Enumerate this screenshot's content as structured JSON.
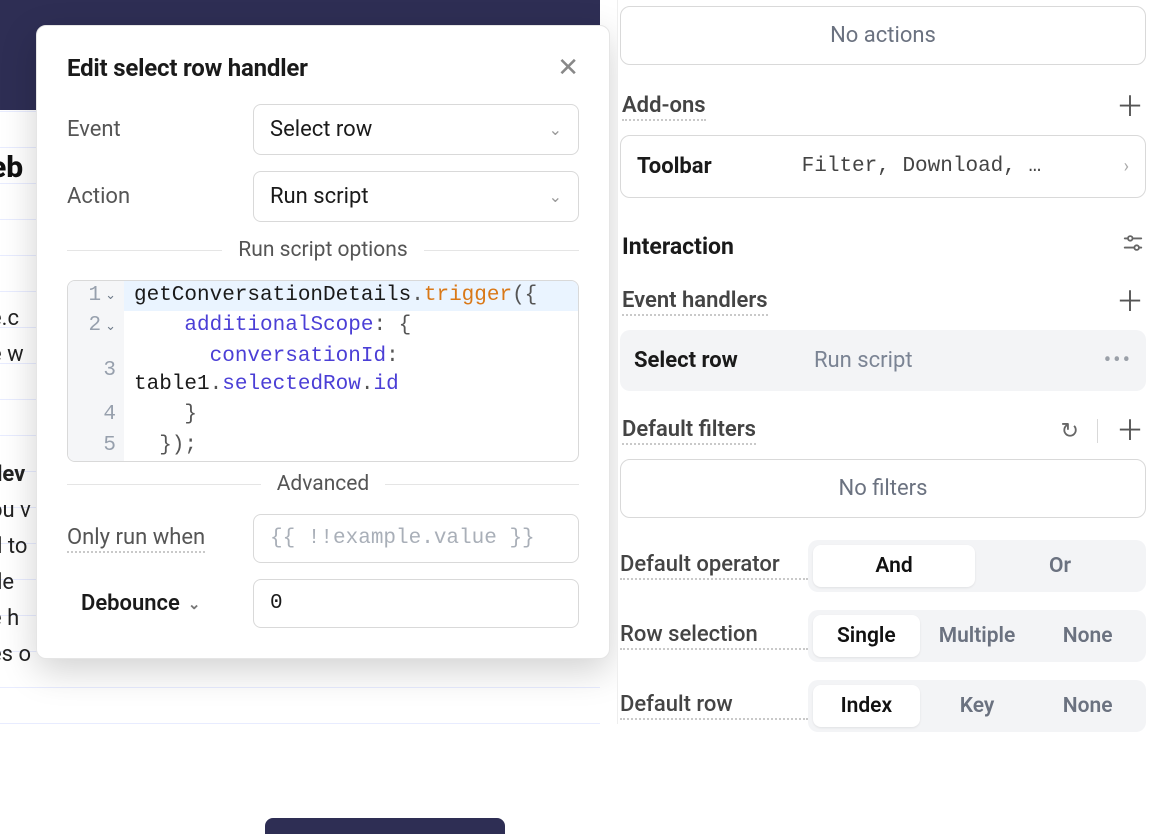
{
  "bg": {
    "eb": "eb",
    "ec": "e.c",
    "ew": "e w",
    "dev": "dev",
    "ouv": "ou v",
    "dto": "d to",
    "de": "de",
    "eh": "e h",
    "eso": "es o"
  },
  "modal": {
    "title": "Edit select row handler",
    "event_label": "Event",
    "event_value": "Select row",
    "action_label": "Action",
    "action_value": "Run script",
    "script_options_label": "Run script options",
    "code": {
      "l1a": "getConversationDetails",
      "l1b": ".",
      "l1c": "trigger",
      "l1d": "({",
      "l2a": "    ",
      "l2b": "additionalScope",
      "l2c": ": {",
      "l3a": "      ",
      "l3b": "conversationId",
      "l3c": ": ",
      "l3d": "table1",
      "l3e": ".",
      "l3f": "selectedRow",
      "l3g": ".",
      "l3h": "id",
      "l4": "    }",
      "l5": "  });"
    },
    "advanced_label": "Advanced",
    "only_run_label": "Only run when",
    "only_run_placeholder": "{{ !!example.value }}",
    "debounce_label": "Debounce",
    "debounce_value": "0"
  },
  "panel": {
    "no_actions": "No actions",
    "addons_heading": "Add-ons",
    "toolbar_label": "Toolbar",
    "toolbar_value": "Filter, Download, …",
    "interaction_heading": "Interaction",
    "event_handlers_heading": "Event handlers",
    "handler_event": "Select row",
    "handler_action": "Run script",
    "default_filters_heading": "Default filters",
    "no_filters": "No filters",
    "default_operator_label": "Default operator",
    "op_and": "And",
    "op_or": "Or",
    "row_selection_label": "Row selection",
    "rs_single": "Single",
    "rs_multiple": "Multiple",
    "rs_none": "None",
    "default_row_label": "Default row",
    "dr_index": "Index",
    "dr_key": "Key",
    "dr_none": "None"
  }
}
